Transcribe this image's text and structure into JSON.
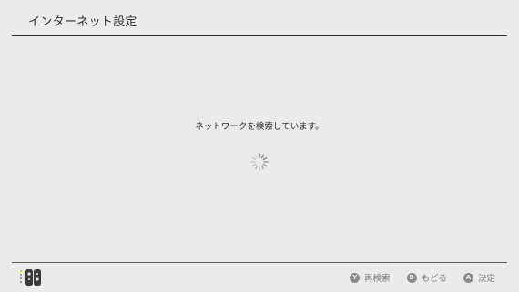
{
  "header": {
    "title": "インターネット設定"
  },
  "main": {
    "status_text": "ネットワークを検索しています。",
    "spinner_icon": "loading-spinner-icon"
  },
  "footer": {
    "controller_icon": "joy-con-icon",
    "actions": [
      {
        "button": "Y",
        "label": "再検索"
      },
      {
        "button": "B",
        "label": "もどる"
      },
      {
        "button": "A",
        "label": "決定"
      }
    ]
  },
  "colors": {
    "background": "#ebebeb",
    "text": "#2d2d2d",
    "muted": "#7a7a7a",
    "controller_indicator": "#c8e000"
  }
}
